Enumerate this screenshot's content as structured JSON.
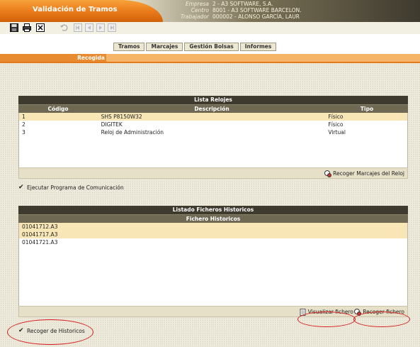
{
  "window": {
    "title": "Validación de Tramos",
    "info_labels": [
      "Empresa",
      "Centro",
      "Trabajador"
    ],
    "info_values": [
      "2 - A3 SOFTWARE, S.A.",
      "8001 - A3 SOFTWARE BARCELON.",
      "000002 - ALONSO GARCÍA, LAUR"
    ]
  },
  "toolbar": {
    "icons": [
      "save-icon",
      "print-icon",
      "close-icon",
      "undo-icon",
      "first-icon",
      "previous-icon",
      "next-icon",
      "last-icon"
    ]
  },
  "nav": {
    "tabs": [
      "Tramos",
      "Marcajes",
      "Gestión Bolsas",
      "Informes"
    ],
    "section": "Recogida"
  },
  "relojes": {
    "title": "Lista Relojes",
    "columns": [
      "Código",
      "Descripción",
      "Tipo"
    ],
    "rows": [
      {
        "codigo": "1",
        "descripcion": "SHS P8150W32",
        "tipo": "Físico"
      },
      {
        "codigo": "2",
        "descripcion": "DIGITEK",
        "tipo": "Físico"
      },
      {
        "codigo": "3",
        "descripcion": "Reloj de Administración",
        "tipo": "Virtual"
      }
    ],
    "action_label": "Recoger Marcajes del Reloj"
  },
  "ejecutar": {
    "label": "Ejecutar Programa de Comunicación",
    "checked": true
  },
  "ficheros": {
    "title": "Listado Ficheros Historicos",
    "column": "Fichero Historicos",
    "rows": [
      "01041712.A3",
      "01041717.A3",
      "01041721.A3"
    ],
    "visualizar_label": "Visualizar fichero",
    "recoger_label": "Recoger fichero"
  },
  "historicos": {
    "label": "Recoger de Historicos",
    "checked": true
  },
  "colors": {
    "orange": "#e9791a",
    "dark_header": "#3f3a2e",
    "row_highlight": "#f9e6b6",
    "annotation_red": "#d41a1a"
  }
}
